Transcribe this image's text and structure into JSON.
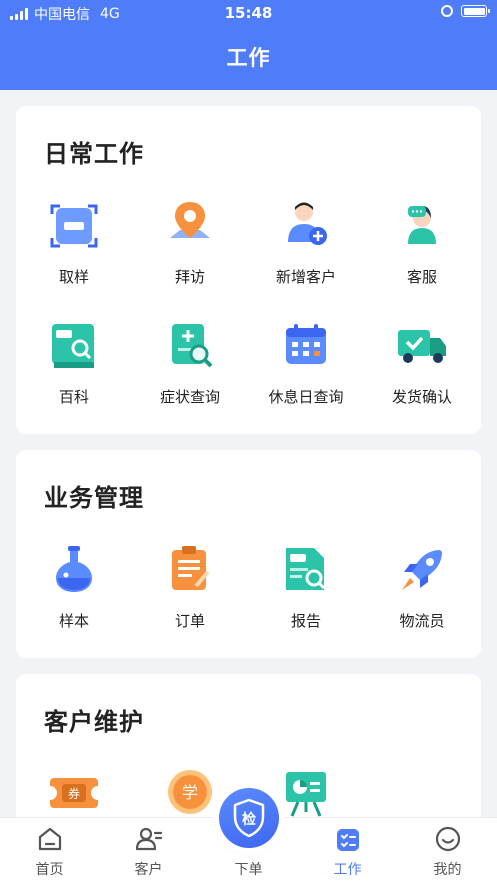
{
  "status_bar": {
    "carrier": "中国电信",
    "network": "4G",
    "time": "15:48"
  },
  "header": {
    "title": "工作"
  },
  "sections": [
    {
      "title": "日常工作",
      "items": [
        {
          "label": "取样",
          "icon": "scan-sample-icon"
        },
        {
          "label": "拜访",
          "icon": "map-pin-icon"
        },
        {
          "label": "新增客户",
          "icon": "add-customer-icon"
        },
        {
          "label": "客服",
          "icon": "customer-service-icon"
        },
        {
          "label": "百科",
          "icon": "encyclopedia-icon"
        },
        {
          "label": "症状查询",
          "icon": "symptom-search-icon"
        },
        {
          "label": "休息日查询",
          "icon": "calendar-icon"
        },
        {
          "label": "发货确认",
          "icon": "truck-icon"
        }
      ]
    },
    {
      "title": "业务管理",
      "items": [
        {
          "label": "样本",
          "icon": "flask-icon"
        },
        {
          "label": "订单",
          "icon": "clipboard-icon"
        },
        {
          "label": "报告",
          "icon": "report-icon"
        },
        {
          "label": "物流员",
          "icon": "rocket-icon"
        }
      ]
    },
    {
      "title": "客户维护",
      "items": [
        {
          "label": "",
          "icon": "coupon-icon",
          "badge": "券"
        },
        {
          "label": "",
          "icon": "learn-icon",
          "badge": "学"
        },
        {
          "label": "",
          "icon": "presentation-icon"
        }
      ]
    }
  ],
  "tabbar": {
    "tabs": [
      {
        "label": "首页",
        "icon": "home-icon"
      },
      {
        "label": "客户",
        "icon": "customer-icon"
      },
      {
        "label": "下单",
        "icon": "inspect-shield-icon",
        "badge": "检"
      },
      {
        "label": "工作",
        "icon": "work-icon",
        "active": true
      },
      {
        "label": "我的",
        "icon": "profile-icon"
      }
    ]
  },
  "colors": {
    "primary": "#4f7df9",
    "background": "#f2f3f7",
    "teal": "#2bc4a8",
    "orange": "#f7913d"
  }
}
